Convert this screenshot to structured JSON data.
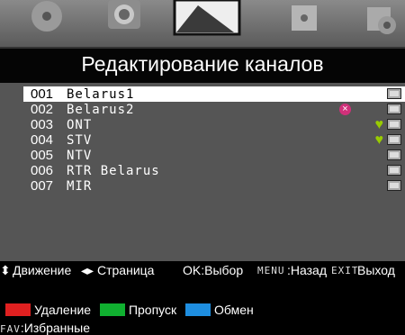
{
  "title": "Редактирование каналов",
  "channels": [
    {
      "num": "001",
      "name": "Belarus1",
      "fav": false,
      "skip": false
    },
    {
      "num": "002",
      "name": "Belarus2",
      "fav": false,
      "skip": true
    },
    {
      "num": "003",
      "name": "ONT",
      "fav": true,
      "skip": false
    },
    {
      "num": "004",
      "name": "STV",
      "fav": true,
      "skip": false
    },
    {
      "num": "005",
      "name": "NTV",
      "fav": false,
      "skip": false
    },
    {
      "num": "006",
      "name": "RTR Belarus",
      "fav": false,
      "skip": false
    },
    {
      "num": "007",
      "name": "MIR",
      "fav": false,
      "skip": false
    }
  ],
  "legend": {
    "delete_color": "#e02020",
    "delete_label": "Удаление",
    "skip_color": "#10b030",
    "skip_label": "Пропуск",
    "swap_color": "#1e8ee0",
    "swap_label": "Обмен"
  },
  "fav": {
    "key": "FAV",
    "label": ":Избранные"
  },
  "footer": {
    "move_label": "Движение",
    "page_label": "Страница",
    "ok_label": "OK:Выбор",
    "menu_key": "MENU",
    "menu_label": ":Назад",
    "exit_key": "EXIT",
    "exit_label": "Выход"
  }
}
